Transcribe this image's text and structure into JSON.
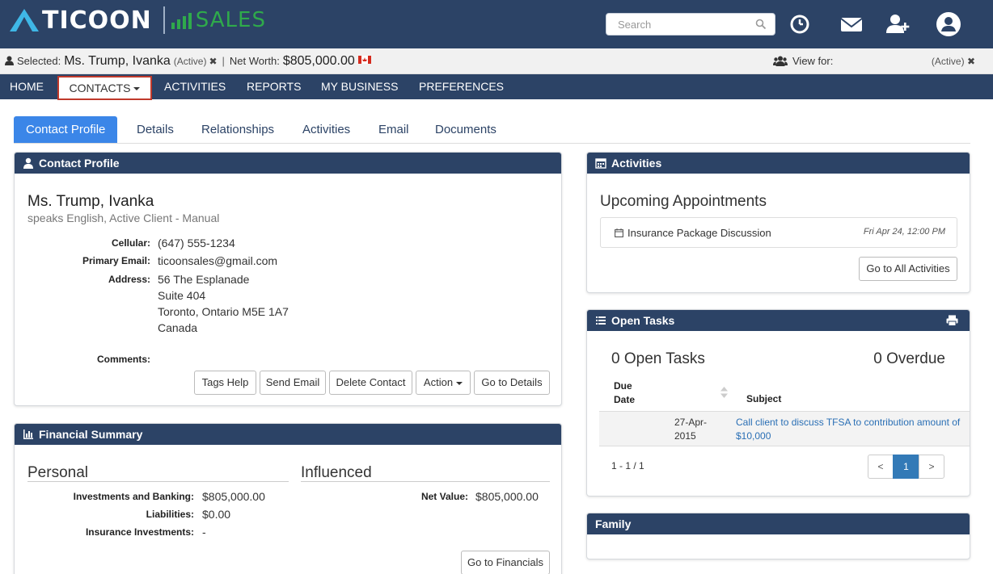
{
  "header": {
    "brand_name": "TICOON",
    "brand_sub": "SALES",
    "search_placeholder": "Search"
  },
  "selected_bar": {
    "selected_label": "Selected:",
    "contact_name": "Ms. Trump, Ivanka",
    "status": "(Active)",
    "net_worth_label": "Net Worth:",
    "net_worth_value": "$805,000.00",
    "view_for_label": "View for:",
    "view_for_status": "(Active)"
  },
  "nav": {
    "home": "HOME",
    "contacts": "CONTACTS",
    "activities": "ACTIVITIES",
    "reports": "REPORTS",
    "my_business": "MY BUSINESS",
    "preferences": "PREFERENCES"
  },
  "tabs": {
    "contact_profile": "Contact Profile",
    "details": "Details",
    "relationships": "Relationships",
    "activities": "Activities",
    "email": "Email",
    "documents": "Documents"
  },
  "contact_profile": {
    "title": "Contact Profile",
    "name": "Ms. Trump, Ivanka",
    "subtitle": "speaks English, Active Client - Manual",
    "cellular_label": "Cellular:",
    "cellular": "(647) 555-1234",
    "email_label": "Primary Email:",
    "email": "ticoonsales@gmail.com",
    "address_label": "Address:",
    "address_line1": "56 The Esplanade",
    "address_line2": "Suite 404",
    "address_line3": "Toronto, Ontario M5E 1A7",
    "address_line4": "Canada",
    "comments_label": "Comments:",
    "buttons": {
      "tags_help": "Tags Help",
      "send_email": "Send Email",
      "delete_contact": "Delete Contact",
      "action": "Action",
      "go_to_details": "Go to Details"
    }
  },
  "financial_summary": {
    "title": "Financial Summary",
    "personal_title": "Personal",
    "influenced_title": "Influenced",
    "investments_label": "Investments and Banking:",
    "investments_value": "$805,000.00",
    "liabilities_label": "Liabilities:",
    "liabilities_value": "$0.00",
    "insurance_label": "Insurance Investments:",
    "insurance_value": "-",
    "net_value_label": "Net Value:",
    "net_value": "$805,000.00",
    "go_to_financials": "Go to Financials"
  },
  "activities_panel": {
    "title": "Activities",
    "upcoming_title": "Upcoming Appointments",
    "appointment_subject": "Insurance Package Discussion",
    "appointment_time": "Fri Apr 24, 12:00 PM",
    "go_to_all": "Go to All Activities"
  },
  "open_tasks": {
    "title": "Open Tasks",
    "count_text": "0 Open Tasks",
    "overdue_text": "0 Overdue",
    "col_due_date_1": "Due",
    "col_due_date_2": "Date",
    "col_subject": "Subject",
    "row_date_1": "27-Apr-",
    "row_date_2": "2015",
    "row_subject_1": "Call client to discuss TFSA to contribution amount of",
    "row_subject_2": "$10,000",
    "pagination_text": "1 - 1 / 1",
    "prev": "<",
    "page": "1",
    "next": ">"
  },
  "family": {
    "title": "Family"
  },
  "colors": {
    "navy": "#2c4366",
    "accent_blue": "#3b86e8",
    "brand_green": "#2faa4b",
    "highlight_red": "#c0392b"
  }
}
